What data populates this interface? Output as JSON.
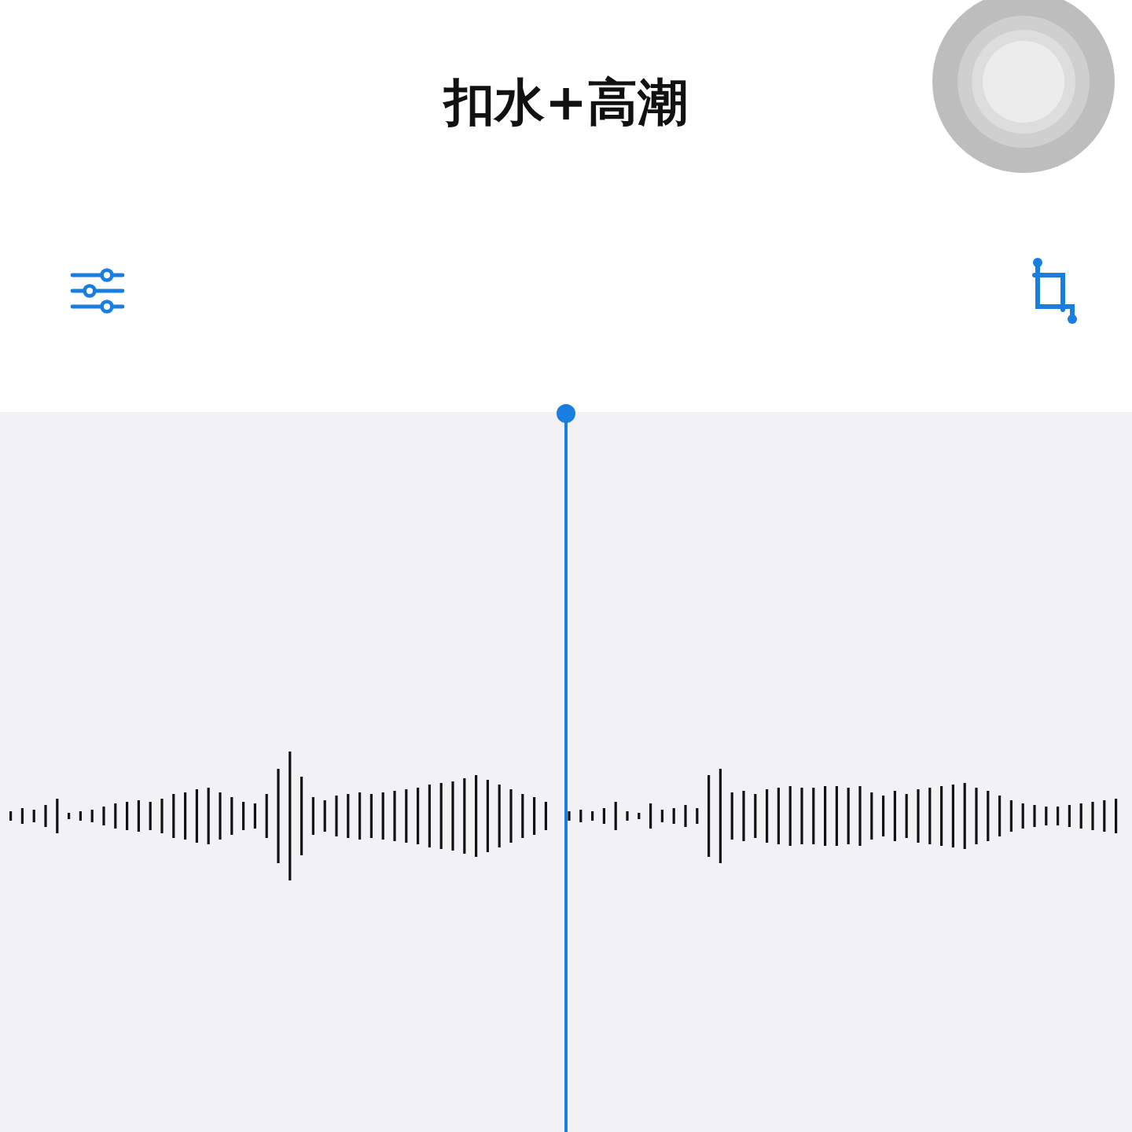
{
  "title": "扣水+高潮"
}
